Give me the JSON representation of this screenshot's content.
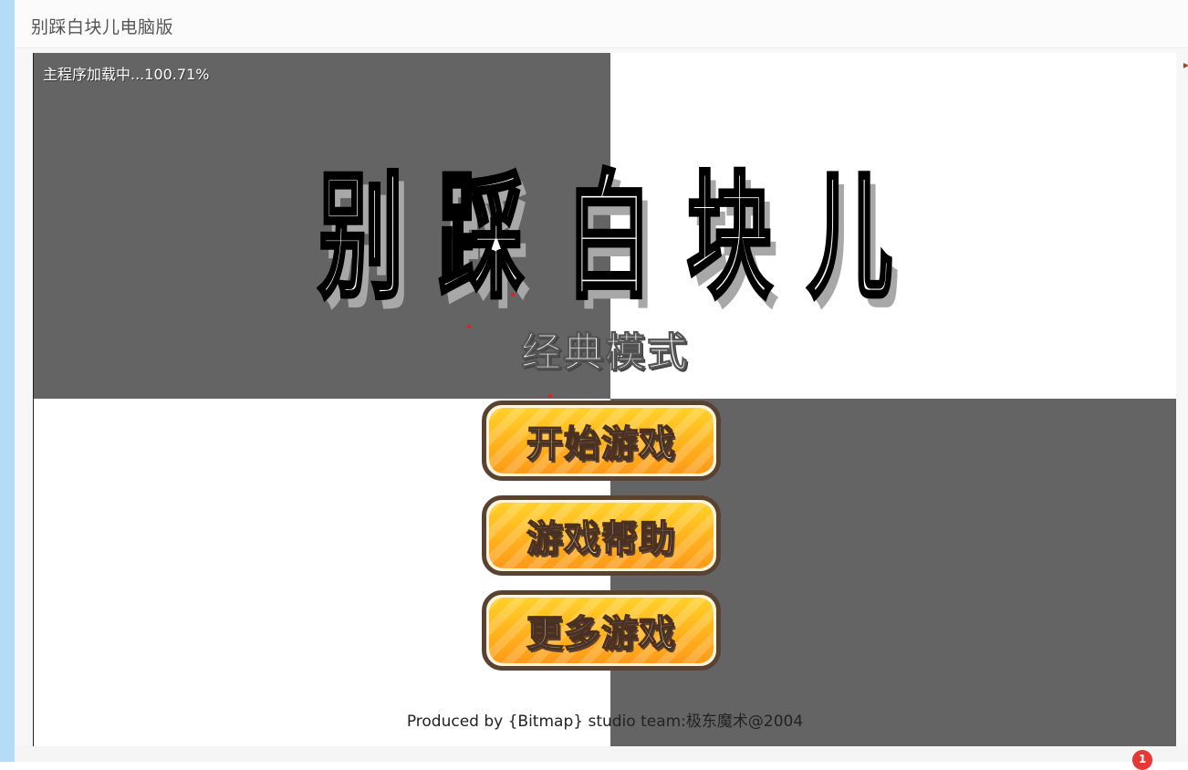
{
  "page": {
    "title": "别踩白块儿电脑版"
  },
  "game": {
    "loading_text": "主程序加载中...100.71%",
    "logo_chars": [
      "别",
      "踩",
      "白",
      "块",
      "儿"
    ],
    "mode_text": "经典模式",
    "buttons": {
      "start": "开始游戏",
      "help": "游戏帮助",
      "more": "更多游戏"
    },
    "credits": "Produced by {Bitmap} studio team:极东魔术@2004"
  },
  "notification": {
    "count": "1"
  },
  "colors": {
    "dark_tile": "#646464",
    "light_tile": "#ffffff",
    "button_orange": "#ffb21d",
    "button_border": "#5a4232",
    "left_strip": "#b4dcf7",
    "badge_red": "#e53935"
  }
}
